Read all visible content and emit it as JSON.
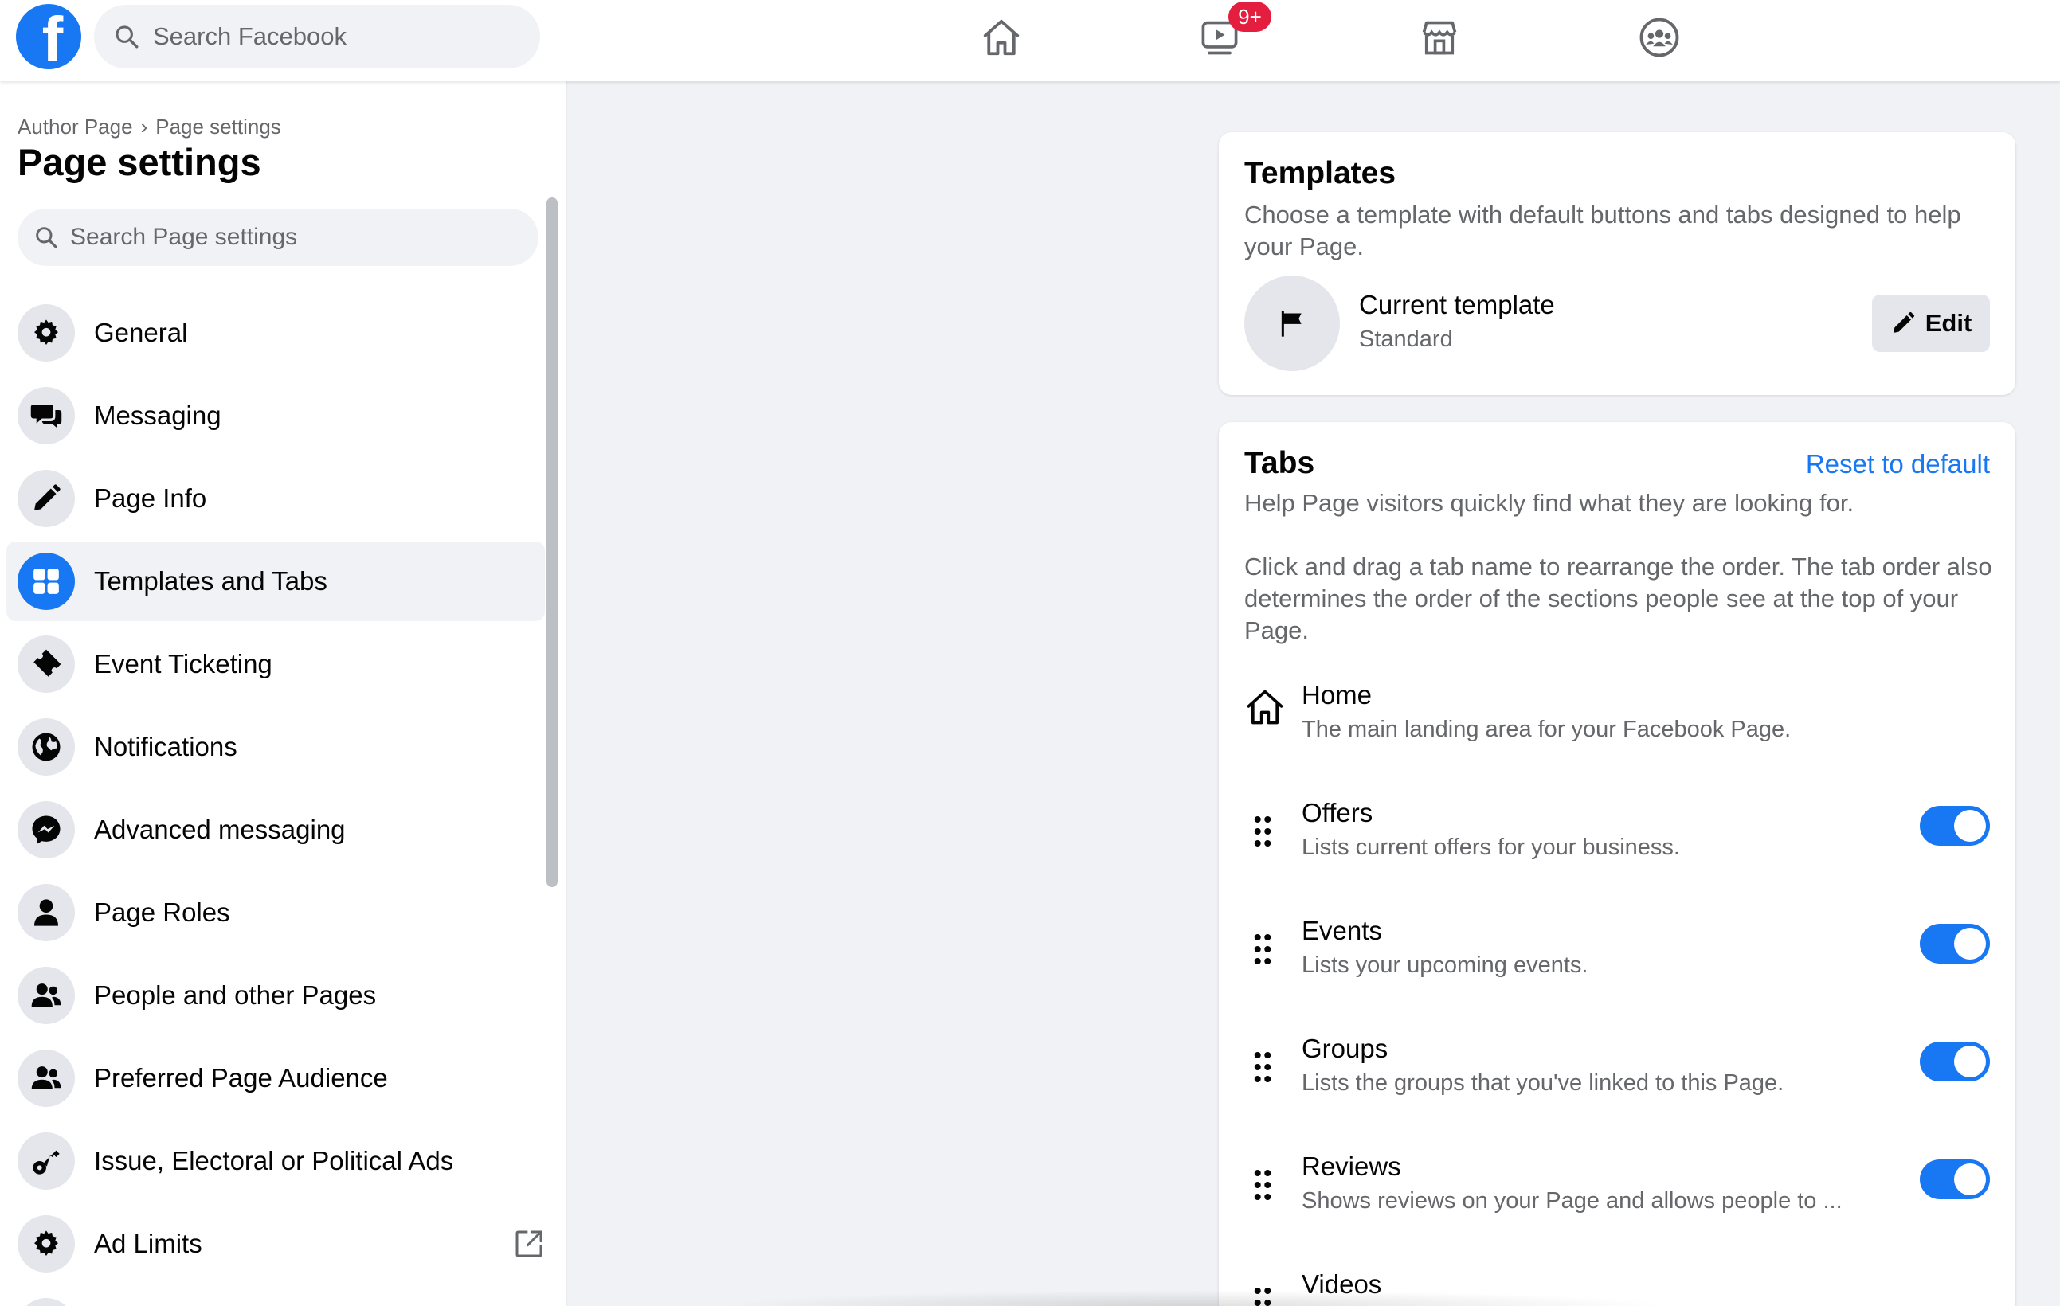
{
  "app": {
    "logo_letter": "f",
    "search_placeholder": "Search Facebook",
    "nav": [
      {
        "icon": "home-icon"
      },
      {
        "icon": "watch-icon",
        "badge": "9+"
      },
      {
        "icon": "marketplace-icon"
      },
      {
        "icon": "groups-icon"
      }
    ],
    "accent_color": "#1877f2",
    "badge_color": "#e41e3f"
  },
  "sidebar": {
    "breadcrumb": [
      "Author Page",
      "Page settings"
    ],
    "breadcrumb_sep": "›",
    "title": "Page settings",
    "search_placeholder": "Search Page settings",
    "items": [
      {
        "label": "General",
        "icon": "gear-icon"
      },
      {
        "label": "Messaging",
        "icon": "chat-icon"
      },
      {
        "label": "Page Info",
        "icon": "pencil-icon"
      },
      {
        "label": "Templates and Tabs",
        "icon": "grid-icon",
        "active": true
      },
      {
        "label": "Event Ticketing",
        "icon": "ticket-icon"
      },
      {
        "label": "Notifications",
        "icon": "globe-icon"
      },
      {
        "label": "Advanced messaging",
        "icon": "messenger-icon"
      },
      {
        "label": "Page Roles",
        "icon": "person-icon"
      },
      {
        "label": "People and other Pages",
        "icon": "people-icon"
      },
      {
        "label": "Preferred Page Audience",
        "icon": "people-icon"
      },
      {
        "label": "Issue, Electoral or Political Ads",
        "icon": "key-icon"
      },
      {
        "label": "Ad Limits",
        "icon": "gear-icon",
        "external": true
      }
    ]
  },
  "templates": {
    "title": "Templates",
    "description": "Choose a template with default buttons and tabs designed to help your Page.",
    "current_label": "Current template",
    "current_value": "Standard",
    "edit_label": "Edit"
  },
  "tabs": {
    "title": "Tabs",
    "reset_label": "Reset to default",
    "description": "Help Page visitors quickly find what they are looking for.",
    "instructions": "Click and drag a tab name to rearrange the order. The tab order also determines the order of the sections people see at the top of your Page.",
    "items": [
      {
        "name": "Home",
        "desc": "The main landing area for your Facebook Page.",
        "icon": "home-outline-icon"
      },
      {
        "name": "Offers",
        "desc": "Lists current offers for your business.",
        "enabled": true
      },
      {
        "name": "Events",
        "desc": "Lists your upcoming events.",
        "enabled": true
      },
      {
        "name": "Groups",
        "desc": "Lists the groups that you've linked to this Page.",
        "enabled": true
      },
      {
        "name": "Reviews",
        "desc": "Shows reviews on your Page and allows people to ...",
        "enabled": true
      },
      {
        "name": "Videos",
        "desc": ""
      }
    ]
  }
}
